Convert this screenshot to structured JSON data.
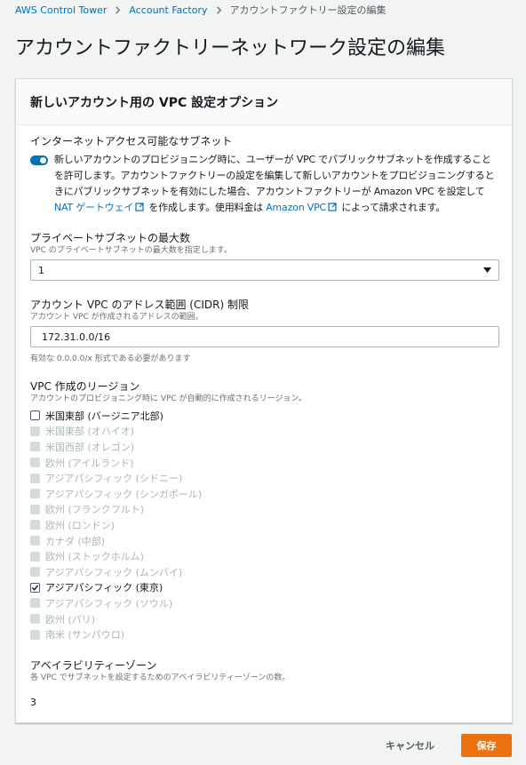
{
  "breadcrumbs": {
    "items": [
      "AWS Control Tower",
      "Account Factory"
    ],
    "current": "アカウントファクトリー設定の編集"
  },
  "page_title": "アカウントファクトリーネットワーク設定の編集",
  "panel": {
    "title": "新しいアカウント用の VPC 設定オプション"
  },
  "internet_access": {
    "label": "インターネットアクセス可能なサブネット",
    "toggle_on": true,
    "text_part1": "新しいアカウントのプロビジョニング時に、ユーザーが VPC でパブリックサブネットを作成することを許可します。アカウントファクトリーの設定を編集して新しいアカウントをプロビジョニングするときにパブリックサブネットを有効にした場合、アカウントファクトリーが Amazon VPC を設定して",
    "link1": "NAT ゲートウェイ",
    "text_part2": "を作成します。使用料金は",
    "link2": "Amazon VPC",
    "text_part3": "によって請求されます。",
    "link_icon": "external-link-icon"
  },
  "private_subnets": {
    "label": "プライベートサブネットの最大数",
    "description": "VPC のプライベートサブネットの最大数を指定します。",
    "selected": "1"
  },
  "cidr": {
    "label": "アカウント VPC のアドレス範囲 (CIDR) 制限",
    "description": "アカウント VPC が作成されるアドレスの範囲。",
    "value": "172.31.0.0/16",
    "hint": "有効な 0.0.0.0/x 形式である必要があります"
  },
  "regions": {
    "label": "VPC 作成のリージョン",
    "description": "アカウントのプロビジョニング時に VPC が自動的に作成されるリージョン。",
    "items": [
      {
        "label": "米国東部 (バージニア北部)",
        "state": "unchecked"
      },
      {
        "label": "米国東部 (オハイオ)",
        "state": "disabled"
      },
      {
        "label": "米国西部 (オレゴン)",
        "state": "disabled"
      },
      {
        "label": "欧州 (アイルランド)",
        "state": "disabled"
      },
      {
        "label": "アジアパシフィック (シドニー)",
        "state": "disabled"
      },
      {
        "label": "アジアパシフィック (シンガポール)",
        "state": "disabled"
      },
      {
        "label": "欧州 (フランクフルト)",
        "state": "disabled"
      },
      {
        "label": "欧州 (ロンドン)",
        "state": "disabled"
      },
      {
        "label": "カナダ (中部)",
        "state": "disabled"
      },
      {
        "label": "欧州 (ストックホルム)",
        "state": "disabled"
      },
      {
        "label": "アジアパシフィック (ムンバイ)",
        "state": "disabled"
      },
      {
        "label": "アジアパシフィック (東京)",
        "state": "checked"
      },
      {
        "label": "アジアパシフィック (ソウル)",
        "state": "disabled"
      },
      {
        "label": "欧州 (パリ)",
        "state": "disabled"
      },
      {
        "label": "南米 (サンパウロ)",
        "state": "disabled"
      }
    ]
  },
  "availability_zones": {
    "label": "アベイラビリティーゾーン",
    "description": "各 VPC でサブネットを設定するためのアベイラビリティーゾーンの数。",
    "value": "3"
  },
  "actions": {
    "cancel": "キャンセル",
    "save": "保存"
  },
  "colors": {
    "accent": "#0073bb",
    "primary_button": "#ec7211",
    "background": "#f2f3f3"
  }
}
